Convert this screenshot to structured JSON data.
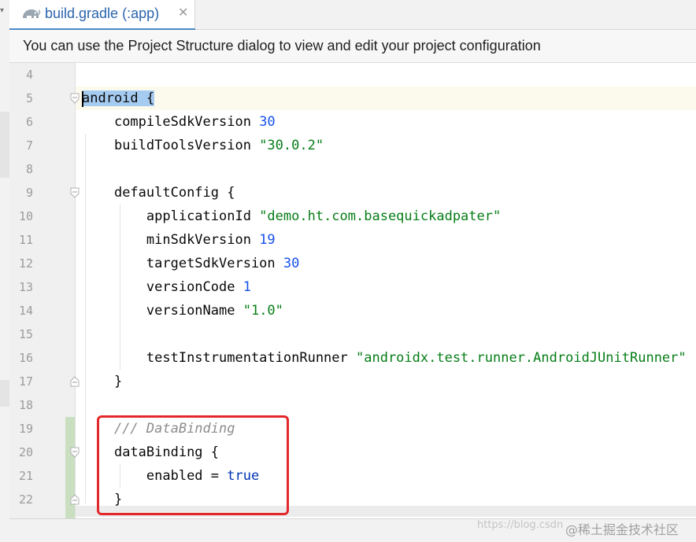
{
  "tab": {
    "title": "build.gradle (:app)",
    "close_icon": "close-icon",
    "icon": "gradle-elephant-icon"
  },
  "banner": {
    "text": "You can use the Project Structure dialog to view and edit your project configuration"
  },
  "editor": {
    "lines": [
      {
        "num": "4"
      },
      {
        "num": "5",
        "kw": "android",
        "rest": " {"
      },
      {
        "num": "6",
        "indent": "    ",
        "key": "compileSdkVersion ",
        "val": "30",
        "valtype": "num"
      },
      {
        "num": "7",
        "indent": "    ",
        "key": "buildToolsVersion ",
        "val": "\"30.0.2\"",
        "valtype": "str"
      },
      {
        "num": "8"
      },
      {
        "num": "9",
        "indent": "    ",
        "key": "defaultConfig {"
      },
      {
        "num": "10",
        "indent": "        ",
        "key": "applicationId ",
        "val": "\"demo.ht.com.basequickadpater\"",
        "valtype": "str"
      },
      {
        "num": "11",
        "indent": "        ",
        "key": "minSdkVersion ",
        "val": "19",
        "valtype": "num"
      },
      {
        "num": "12",
        "indent": "        ",
        "key": "targetSdkVersion ",
        "val": "30",
        "valtype": "num"
      },
      {
        "num": "13",
        "indent": "        ",
        "key": "versionCode ",
        "val": "1",
        "valtype": "num"
      },
      {
        "num": "14",
        "indent": "        ",
        "key": "versionName ",
        "val": "\"1.0\"",
        "valtype": "str"
      },
      {
        "num": "15"
      },
      {
        "num": "16",
        "indent": "        ",
        "key": "testInstrumentationRunner ",
        "val": "\"androidx.test.runner.AndroidJUnitRunner\"",
        "valtype": "str"
      },
      {
        "num": "17",
        "indent": "    ",
        "key": "}"
      },
      {
        "num": "18"
      },
      {
        "num": "19",
        "indent": "    ",
        "comment": "/// DataBinding"
      },
      {
        "num": "20",
        "indent": "    ",
        "key": "dataBinding {"
      },
      {
        "num": "21",
        "indent": "        ",
        "key": "enabled = ",
        "val": "true",
        "valtype": "kw"
      },
      {
        "num": "22",
        "indent": "    ",
        "key": "}"
      }
    ]
  },
  "watermark": {
    "url": "https://blog.csdn",
    "brand": "@稀土掘金技术社区"
  },
  "colors": {
    "accent": "#4a88c7",
    "highlight_box": "#e3272a",
    "string": "#067d17",
    "number": "#1750eb",
    "keyword": "#0033b3"
  }
}
